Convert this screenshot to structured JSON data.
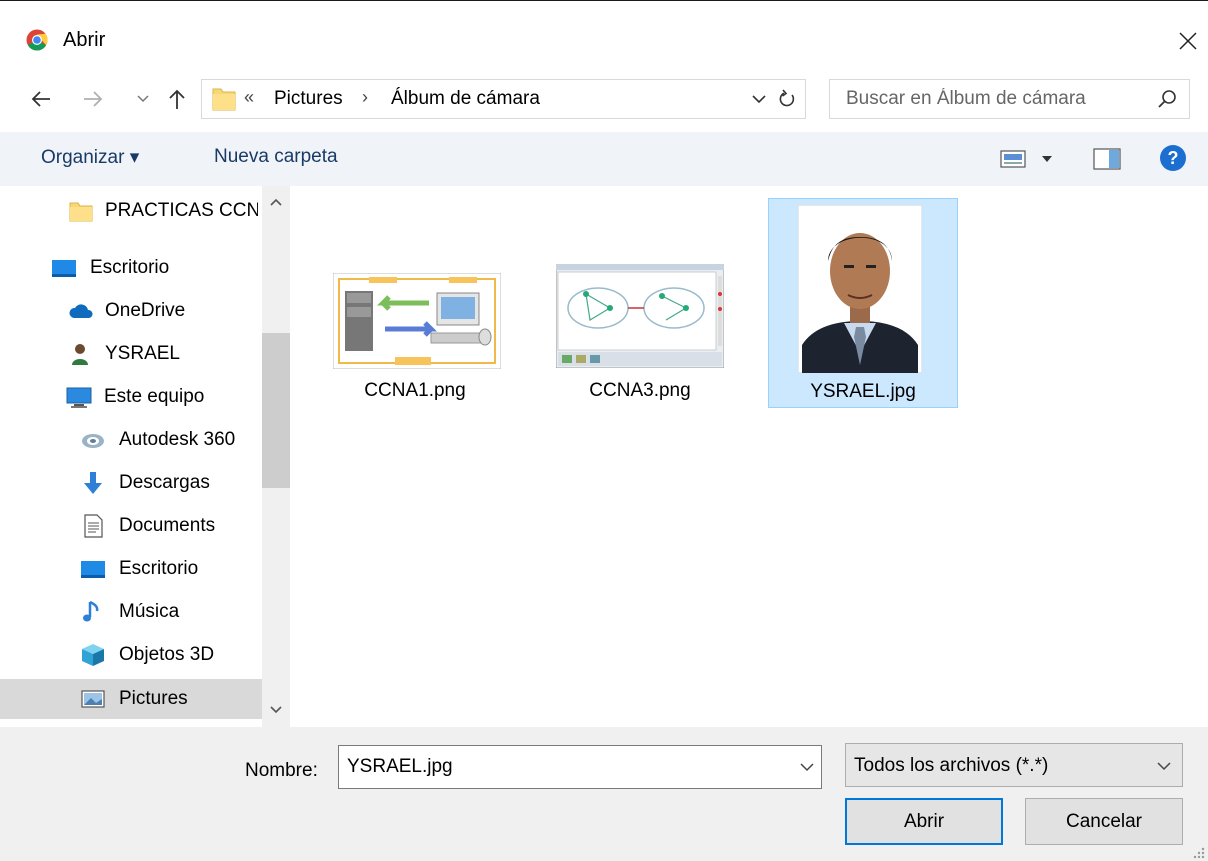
{
  "window": {
    "title": "Abrir",
    "app_icon": "chrome-icon"
  },
  "address_bar": {
    "overflow": "«",
    "crumbs": [
      "Pictures",
      "Álbum de cámara"
    ]
  },
  "search": {
    "placeholder": "Buscar en Álbum de cámara"
  },
  "toolbar": {
    "organize_label": "Organizar ▾",
    "new_folder_label": "Nueva carpeta"
  },
  "nav": {
    "items": [
      {
        "label": "PRACTICAS CCN",
        "icon": "folder-icon"
      },
      {
        "label": "Escritorio",
        "icon": "desktop-icon"
      },
      {
        "label": "OneDrive",
        "icon": "onedrive-icon"
      },
      {
        "label": "YSRAEL",
        "icon": "user-icon"
      },
      {
        "label": "Este equipo",
        "icon": "computer-icon"
      },
      {
        "label": "Autodesk 360",
        "icon": "autodesk-icon"
      },
      {
        "label": "Descargas",
        "icon": "download-icon"
      },
      {
        "label": "Documents",
        "icon": "documents-icon"
      },
      {
        "label": "Escritorio",
        "icon": "desktop-icon"
      },
      {
        "label": "Música",
        "icon": "music-icon"
      },
      {
        "label": "Objetos 3D",
        "icon": "objects3d-icon"
      },
      {
        "label": "Pictures",
        "icon": "pictures-icon"
      }
    ],
    "selected": "Pictures"
  },
  "files": [
    {
      "name": "CCNA1.png"
    },
    {
      "name": "CCNA3.png"
    },
    {
      "name": "YSRAEL.jpg"
    }
  ],
  "bottom": {
    "name_label": "Nombre:",
    "name_value": "YSRAEL.jpg",
    "filter_value": "Todos los archivos (*.*)",
    "open_label": "Abrir",
    "cancel_label": "Cancelar"
  },
  "colors": {
    "accent": "#0078d7",
    "selection": "#cce8ff",
    "toolbar_bg": "#f0f4f9",
    "footer_bg": "#f0f0f0"
  }
}
